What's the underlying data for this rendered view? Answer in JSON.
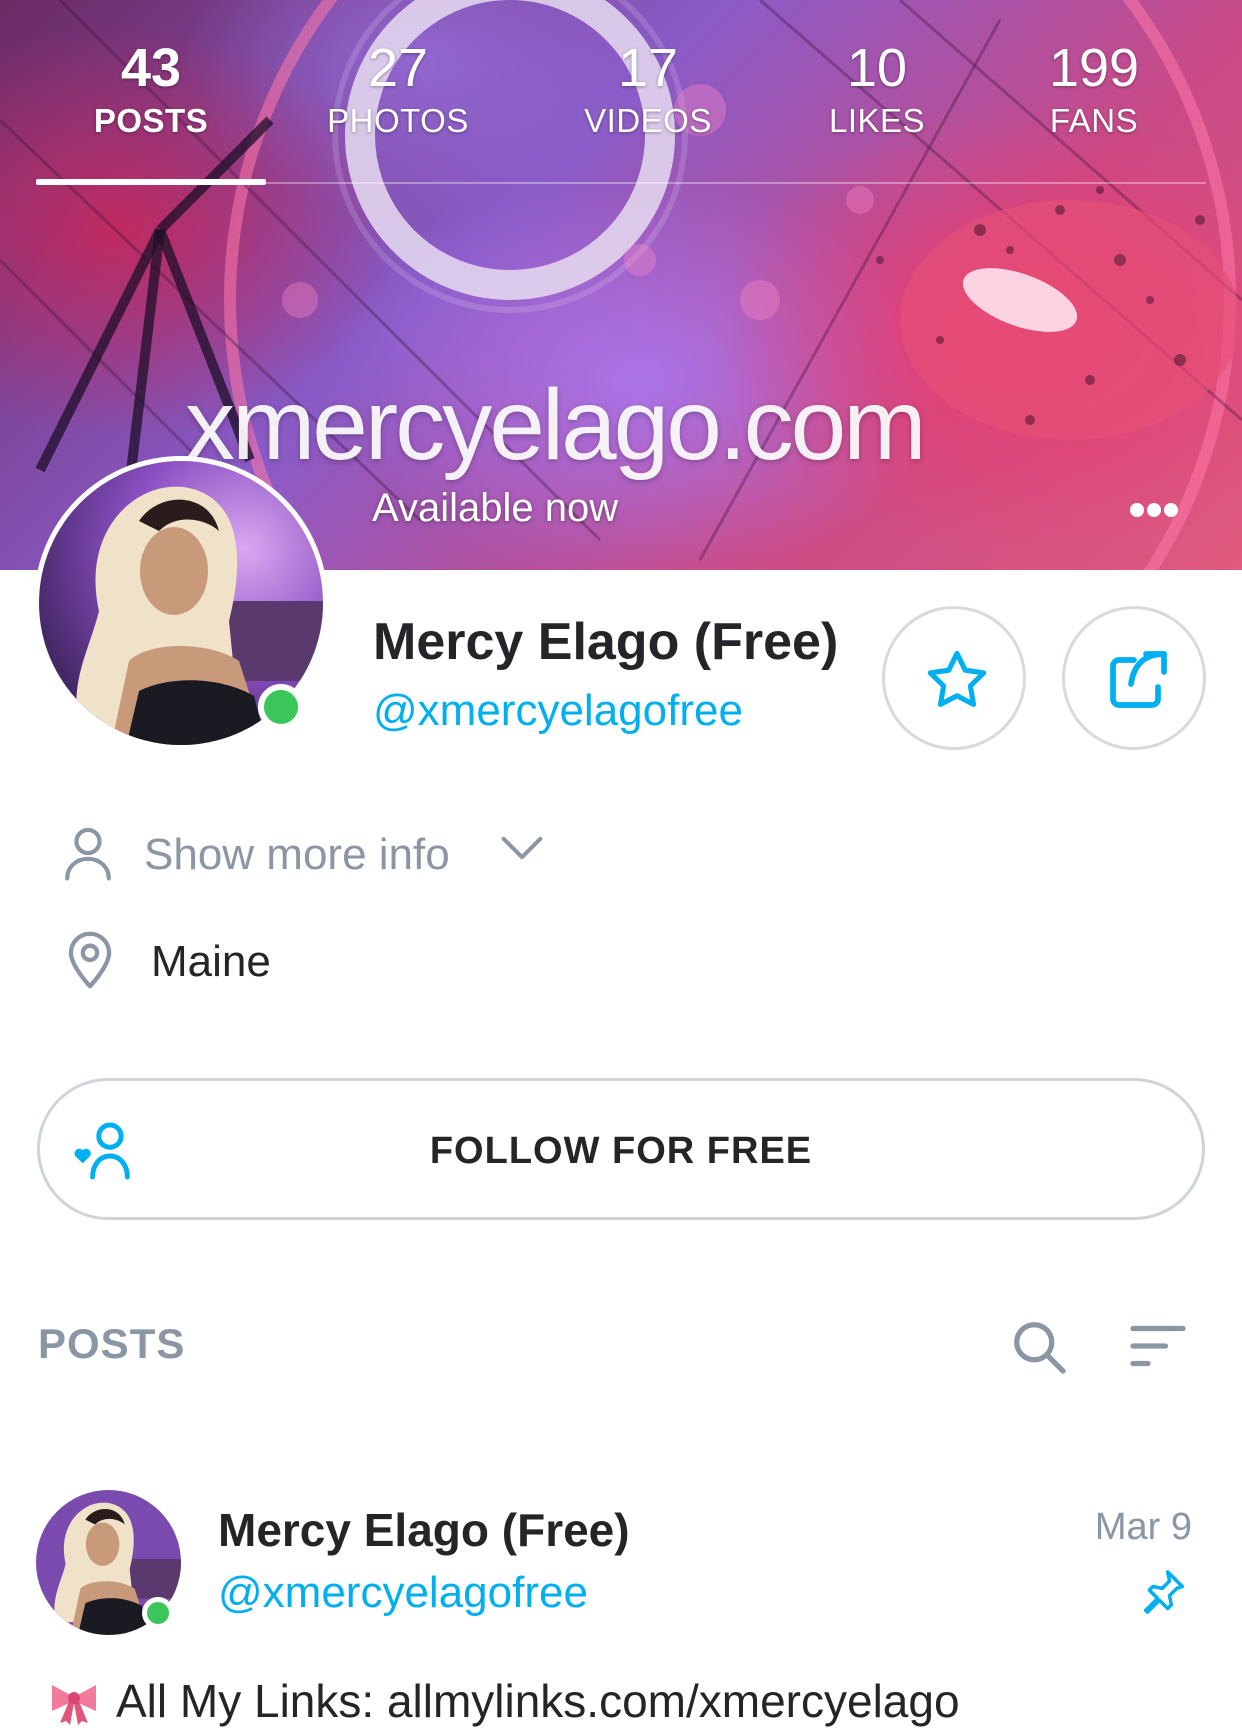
{
  "stats": [
    {
      "value": "43",
      "label": "POSTS",
      "active": true
    },
    {
      "value": "27",
      "label": "PHOTOS",
      "active": false
    },
    {
      "value": "17",
      "label": "VIDEOS",
      "active": false
    },
    {
      "value": "10",
      "label": "LIKES",
      "active": false
    },
    {
      "value": "199",
      "label": "FANS",
      "active": false
    }
  ],
  "cover": {
    "site_text": "xmercyelago.com",
    "availability": "Available now",
    "more_icon": "more-horizontal-icon"
  },
  "profile": {
    "name": "Mercy Elago (Free)",
    "handle": "@xmercyelagofree",
    "online": true,
    "favorite_icon": "star-icon",
    "share_icon": "share-icon"
  },
  "info": {
    "show_more_label": "Show more info",
    "location": "Maine"
  },
  "follow_button": {
    "label": "FOLLOW FOR FREE",
    "icon": "follow-user-heart-icon"
  },
  "posts_section": {
    "title": "POSTS",
    "search_icon": "search-icon",
    "sort_icon": "sort-icon"
  },
  "post": {
    "author_name": "Mercy Elago (Free)",
    "author_handle": "@xmercyelagofree",
    "date": "Mar 9",
    "pinned": true,
    "emoji_icon": "ribbon-bow-icon",
    "text": "All My Links: allmylinks.com/xmercyelago"
  },
  "colors": {
    "accent": "#00aff0",
    "muted": "#8a96a3",
    "text": "#242529",
    "online": "#3ac65a",
    "border": "#cfd4da"
  }
}
